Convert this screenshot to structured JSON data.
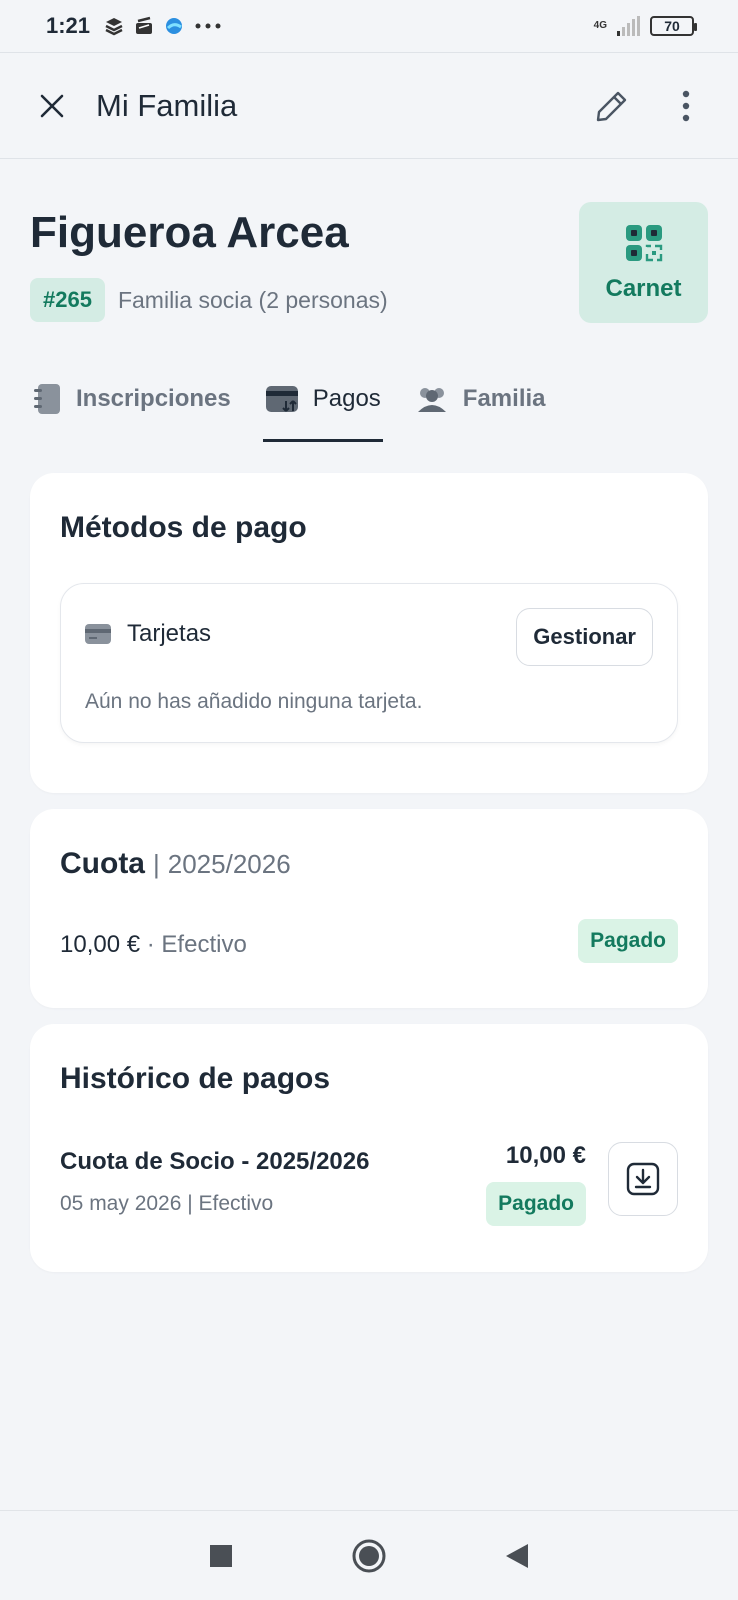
{
  "status_bar": {
    "time": "1:21",
    "network": "4G",
    "battery": "70",
    "icons": [
      "layers-icon",
      "stack-icon",
      "browser-icon",
      "more-dots-icon",
      "signal-icon",
      "battery-icon"
    ]
  },
  "app_bar": {
    "title": "Mi Familia",
    "icons": [
      "close-icon",
      "edit-pencil-icon",
      "more-vertical-icon"
    ]
  },
  "family": {
    "name": "Figueroa Arcea",
    "id": "#265",
    "description": "Familia socia (2 personas)"
  },
  "carnet": {
    "label": "Carnet",
    "icon": "qr-code-icon"
  },
  "tabs": [
    {
      "label": "Inscripciones",
      "icon": "notebook-icon",
      "active": false
    },
    {
      "label": "Pagos",
      "icon": "card-exchange-icon",
      "active": true
    },
    {
      "label": "Familia",
      "icon": "people-icon",
      "active": false
    }
  ],
  "payment_methods": {
    "title": "Métodos de pago",
    "cards_label": "Tarjetas",
    "manage_button": "Gestionar",
    "empty_text": "Aún no has añadido ninguna tarjeta."
  },
  "fee": {
    "title": "Cuota",
    "separator": "|",
    "season": "2025/2026",
    "amount": "10,00 €",
    "method_sep": "·",
    "method": "Efectivo",
    "status": "Pagado"
  },
  "history": {
    "title": "Histórico de pagos",
    "items": [
      {
        "name": "Cuota de Socio - 2025/2026",
        "subtitle": "05 may 2026 | Efectivo",
        "amount": "10,00 €",
        "status": "Pagado"
      }
    ]
  },
  "colors": {
    "accent": "#137a5e",
    "accent_bg": "#d4ece4",
    "paid_bg": "#daf3e6",
    "text": "#1f2a37",
    "muted": "#6b7480",
    "background": "#f3f5f8"
  },
  "nav": {
    "icons": [
      "recents-square-icon",
      "home-circle-icon",
      "back-triangle-icon"
    ]
  }
}
